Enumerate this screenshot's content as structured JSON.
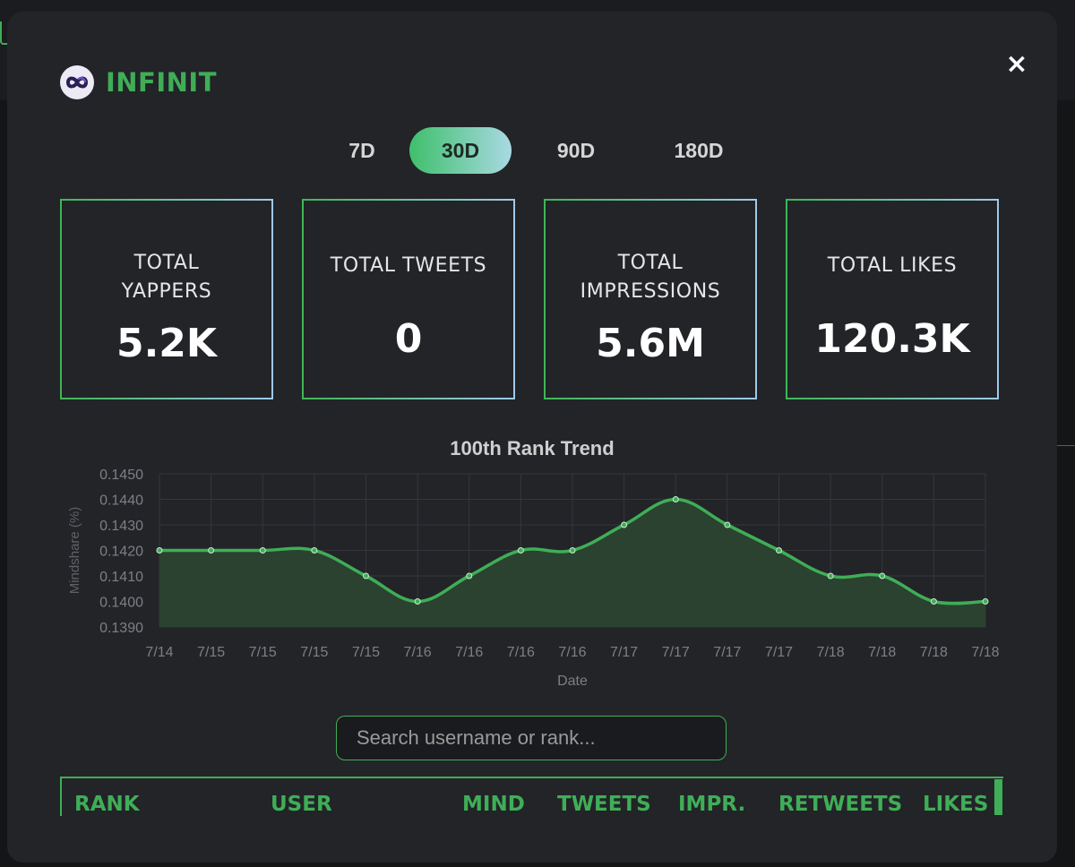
{
  "brand": {
    "name": "INFINIT"
  },
  "close": {
    "symbol": "×"
  },
  "tabs": [
    {
      "label": "7D",
      "active": false
    },
    {
      "label": "30D",
      "active": true
    },
    {
      "label": "90D",
      "active": false
    },
    {
      "label": "180D",
      "active": false
    }
  ],
  "stats": [
    {
      "label_lines": [
        "TOTAL",
        "YAPPERS"
      ],
      "value": "5.2K"
    },
    {
      "label_lines": [
        "TOTAL TWEETS"
      ],
      "value": "0"
    },
    {
      "label_lines": [
        "TOTAL",
        "IMPRESSIONS"
      ],
      "value": "5.6M"
    },
    {
      "label_lines": [
        "TOTAL LIKES"
      ],
      "value": "120.3K"
    }
  ],
  "chart_data": {
    "type": "area",
    "title": "100th Rank Trend",
    "xlabel": "Date",
    "ylabel": "Mindshare (%)",
    "x": [
      "7/14",
      "7/15",
      "7/15",
      "7/15",
      "7/15",
      "7/16",
      "7/16",
      "7/16",
      "7/16",
      "7/17",
      "7/17",
      "7/17",
      "7/17",
      "7/18",
      "7/18",
      "7/18",
      "7/18"
    ],
    "y": [
      0.142,
      0.142,
      0.142,
      0.142,
      0.141,
      0.14,
      0.141,
      0.142,
      0.142,
      0.143,
      0.144,
      0.143,
      0.142,
      0.141,
      0.141,
      0.14,
      0.14
    ],
    "ylim": [
      0.139,
      0.145
    ],
    "yticks": [
      "0.1450",
      "0.1440",
      "0.1430",
      "0.1420",
      "0.1410",
      "0.1400",
      "0.1390"
    ],
    "grid": true,
    "line_color": "#3fae57",
    "fill_color": "#2b4230"
  },
  "search": {
    "placeholder": "Search username or rank..."
  },
  "table": {
    "headers": [
      "RANK",
      "USER",
      "MIND",
      "TWEETS",
      "IMPR.",
      "RETWEETS",
      "LIKES"
    ]
  },
  "colors": {
    "accent": "#3fae57",
    "modal_bg": "#222428"
  }
}
